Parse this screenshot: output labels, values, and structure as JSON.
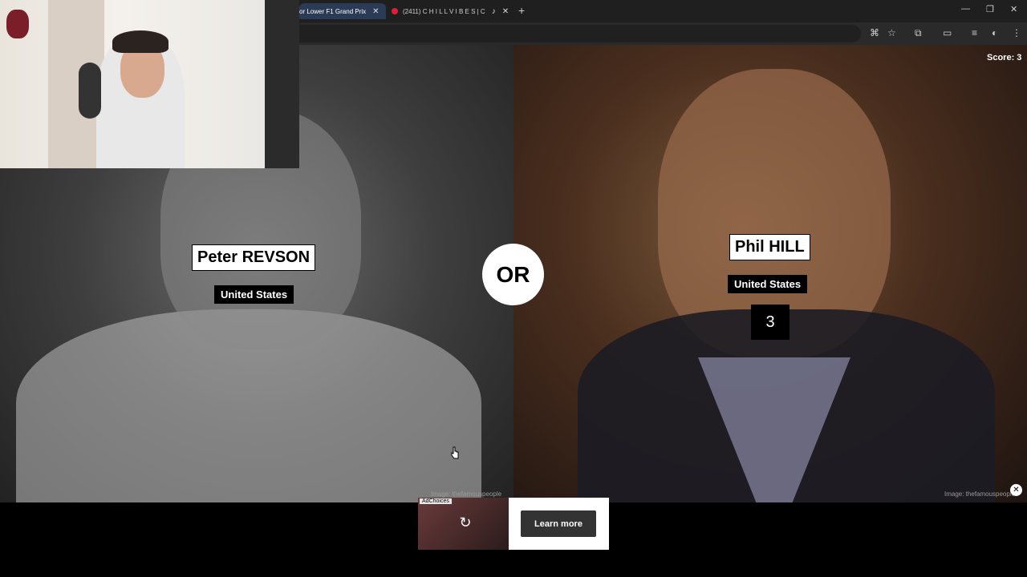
{
  "browser": {
    "tabs": [
      {
        "title": "or Lower F1 Grand Prix",
        "active": true
      },
      {
        "title": "(2411) C H I L L V I B E S | C",
        "active": false
      }
    ]
  },
  "game": {
    "score_label": "Score: 3",
    "or_label": "OR",
    "left": {
      "name": "Peter REVSON",
      "country": "United States",
      "credit": "Image: thefamouspeople"
    },
    "right": {
      "name": "Phil HILL",
      "country": "United States",
      "value": "3",
      "credit": "Image: thefamouspeople"
    }
  },
  "ad": {
    "choices_label": "AdChoices",
    "learn_more_label": "Learn more"
  }
}
